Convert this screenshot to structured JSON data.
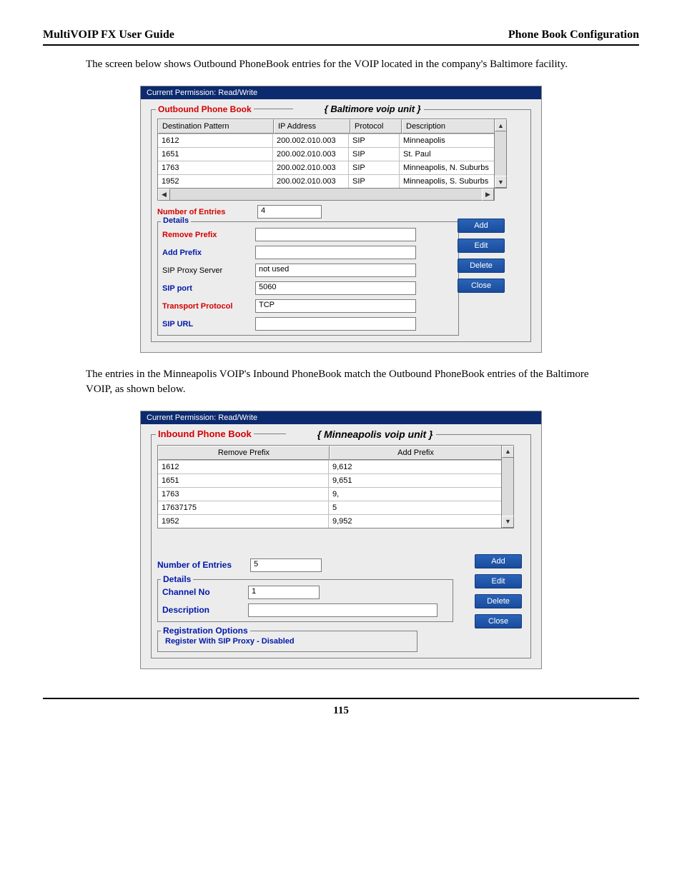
{
  "header": {
    "left": "MultiVOIP FX User Guide",
    "right": "Phone Book Configuration"
  },
  "para1": "The screen below shows Outbound PhoneBook entries for the VOIP located in the company's Baltimore facility.",
  "para2": "The entries in the Minneapolis VOIP's Inbound PhoneBook match the Outbound PhoneBook entries of the Baltimore VOIP, as shown below.",
  "page_number": "115",
  "outbound": {
    "title_bar": "Current Permission:  Read/Write",
    "legend": "Outbound Phone Book",
    "annot": "{ Baltimore voip unit }",
    "columns": {
      "c1": "Destination Pattern",
      "c2": "IP Address",
      "c3": "Protocol",
      "c4": "Description"
    },
    "rows": [
      {
        "c1": "1612",
        "c2": "200.002.010.003",
        "c3": "SIP",
        "c4": "Minneapolis"
      },
      {
        "c1": "1651",
        "c2": "200.002.010.003",
        "c3": "SIP",
        "c4": "St. Paul"
      },
      {
        "c1": "1763",
        "c2": "200.002.010.003",
        "c3": "SIP",
        "c4": "Minneapolis, N. Suburbs"
      },
      {
        "c1": "1952",
        "c2": "200.002.010.003",
        "c3": "SIP",
        "c4": "Minneapolis, S. Suburbs"
      }
    ],
    "num_entries_label": "Number of Entries",
    "num_entries_value": "4",
    "details_legend": "Details",
    "fields": {
      "remove_prefix": {
        "label": "Remove Prefix",
        "value": ""
      },
      "add_prefix": {
        "label": "Add Prefix",
        "value": ""
      },
      "sip_proxy": {
        "label": "SIP Proxy Server",
        "value": "not used"
      },
      "sip_port": {
        "label": "SIP port",
        "value": "5060"
      },
      "transport": {
        "label": "Transport Protocol",
        "value": "TCP"
      },
      "sip_url": {
        "label": "SIP URL",
        "value": ""
      }
    },
    "buttons": {
      "add": "Add",
      "edit": "Edit",
      "del": "Delete",
      "close": "Close"
    }
  },
  "inbound": {
    "title_bar": "Current Permission:  Read/Write",
    "legend": "Inbound Phone Book",
    "annot": "{ Minneapolis voip unit }",
    "columns": {
      "c1": "Remove Prefix",
      "c2": "Add Prefix"
    },
    "rows": [
      {
        "c1": "1612",
        "c2": "9,612"
      },
      {
        "c1": "1651",
        "c2": "9,651"
      },
      {
        "c1": "1763",
        "c2": "9,"
      },
      {
        "c1": "17637175",
        "c2": "5"
      },
      {
        "c1": "1952",
        "c2": "9,952"
      }
    ],
    "num_entries_label": "Number of Entries",
    "num_entries_value": "5",
    "details_legend": "Details",
    "channel_label": "Channel No",
    "channel_value": "1",
    "description_label": "Description",
    "description_value": "",
    "reg_legend": "Registration Options",
    "reg_text": "Register With SIP Proxy  - Disabled",
    "buttons": {
      "add": "Add",
      "edit": "Edit",
      "del": "Delete",
      "close": "Close"
    }
  }
}
